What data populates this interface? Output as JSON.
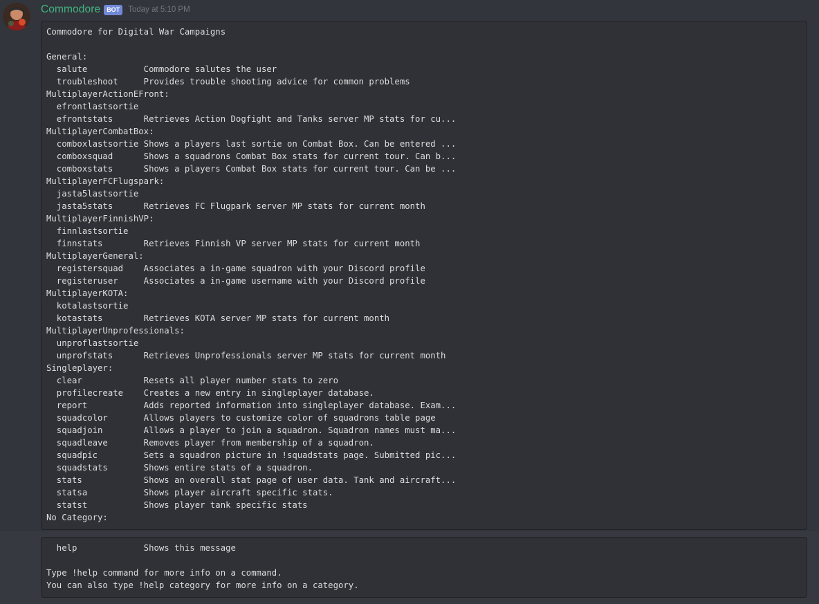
{
  "message": {
    "author": "Commodore",
    "bot_tag": "BOT",
    "timestamp": "Today at 5:10 PM",
    "avatar_icon": "avatar-icon"
  },
  "colors": {
    "username": "#43b581",
    "bot_tag_bg": "#7289da",
    "background": "#36393f",
    "codeblock_bg": "#2f3136"
  },
  "codeblock1": {
    "lines": [
      "Commodore for Digital War Campaigns",
      "",
      "General:",
      "  salute           Commodore salutes the user",
      "  troubleshoot     Provides trouble shooting advice for common problems",
      "MultiplayerActionEFront:",
      "  efrontlastsortie",
      "  efrontstats      Retrieves Action Dogfight and Tanks server MP stats for cu...",
      "MultiplayerCombatBox:",
      "  comboxlastsortie Shows a players last sortie on Combat Box. Can be entered ...",
      "  comboxsquad      Shows a squadrons Combat Box stats for current tour. Can b...",
      "  comboxstats      Shows a players Combat Box stats for current tour. Can be ...",
      "MultiplayerFCFlugspark:",
      "  jasta5lastsortie",
      "  jasta5stats      Retrieves FC Flugpark server MP stats for current month",
      "MultiplayerFinnishVP:",
      "  finnlastsortie",
      "  finnstats        Retrieves Finnish VP server MP stats for current month",
      "MultiplayerGeneral:",
      "  registersquad    Associates a in-game squadron with your Discord profile",
      "  registeruser     Associates a in-game username with your Discord profile",
      "MultiplayerKOTA:",
      "  kotalastsortie",
      "  kotastats        Retrieves KOTA server MP stats for current month",
      "MultiplayerUnprofessionals:",
      "  unproflastsortie",
      "  unprofstats      Retrieves Unprofessionals server MP stats for current month",
      "Singleplayer:",
      "  clear            Resets all player number stats to zero",
      "  profilecreate    Creates a new entry in singleplayer database.",
      "  report           Adds reported information into singleplayer database. Exam...",
      "  squadcolor       Allows players to customize color of squadrons table page",
      "  squadjoin        Allows a player to join a squadron. Squadron names must ma...",
      "  squadleave       Removes player from membership of a squadron.",
      "  squadpic         Sets a squadron picture in !squadstats page. Submitted pic...",
      "  squadstats       Shows entire stats of a squadron.",
      "  stats            Shows an overall stat page of user data. Tank and aircraft...",
      "  statsa           Shows player aircraft specific stats.",
      "  statst           Shows player tank specific stats",
      "No Category:"
    ]
  },
  "codeblock2": {
    "lines": [
      "  help             Shows this message",
      "",
      "Type !help command for more info on a command.",
      "You can also type !help category for more info on a category."
    ]
  }
}
